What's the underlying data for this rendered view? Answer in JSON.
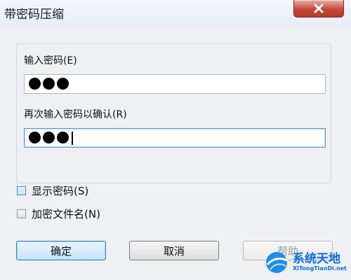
{
  "window": {
    "title": "带密码压缩"
  },
  "fields": {
    "password_label": "输入密码(E)",
    "password_mask": "●●●",
    "confirm_label": "再次输入密码以确认(R)",
    "confirm_mask": "●●●"
  },
  "options": {
    "show_password_label": "显示密码(S)",
    "show_password_checked": false,
    "encrypt_filenames_label": "加密文件名(N)",
    "encrypt_filenames_checked": false
  },
  "buttons": {
    "ok": "确定",
    "cancel": "取消",
    "help": "帮助"
  },
  "watermark": {
    "cn": "系统天地",
    "en": "XiTongTianDi.net"
  },
  "colors": {
    "close_red": "#c7493a",
    "focus_blue": "#5b9bd5",
    "brand_blue": "#0d6fd6"
  }
}
